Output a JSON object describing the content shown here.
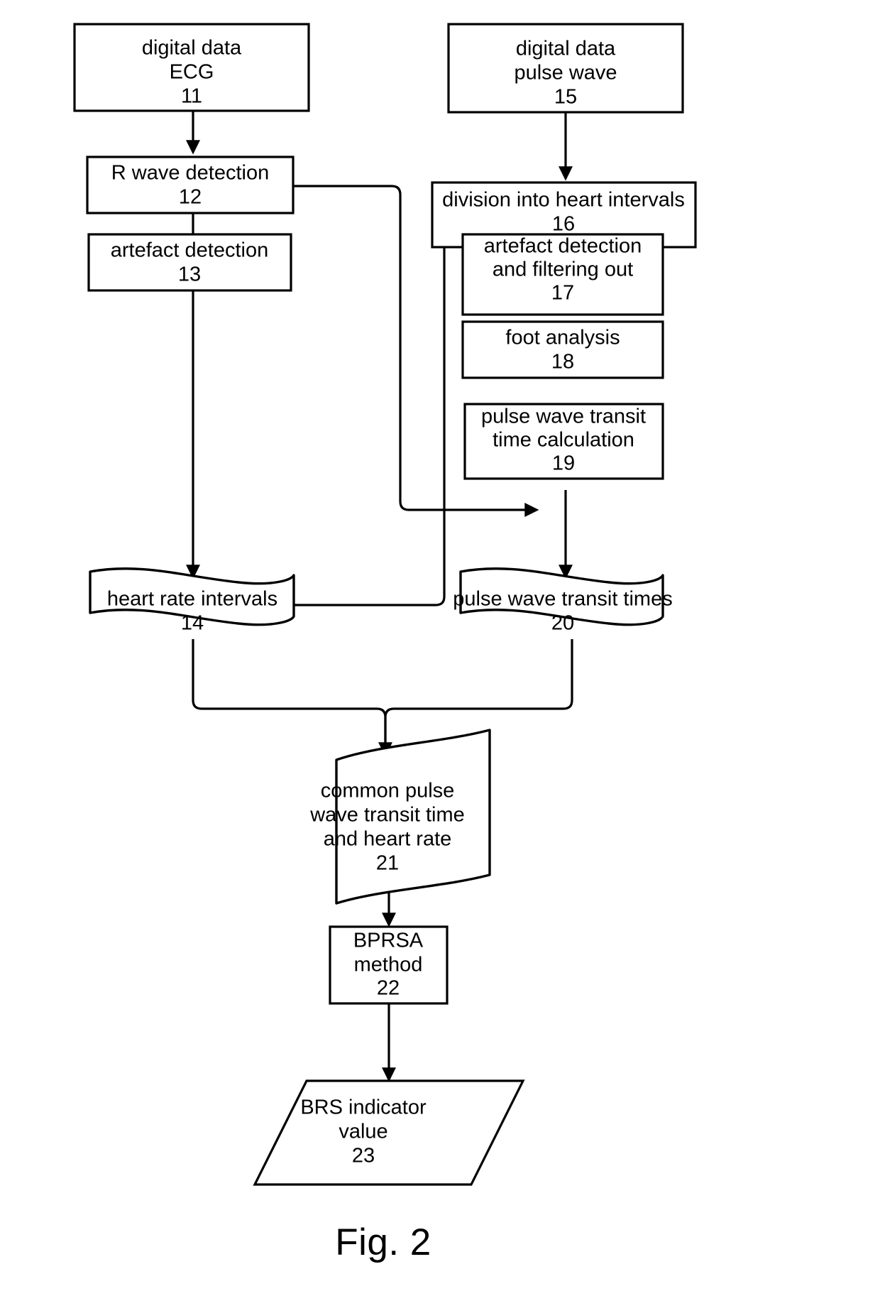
{
  "figure": {
    "caption": "Fig. 2",
    "type": "process-flow-diagram",
    "subject": "BRS indicator computation from ECG and pulse wave digital data"
  },
  "nodes": {
    "n11": {
      "shape": "rectangle",
      "line1": "digital data",
      "line2": "ECG",
      "ref": "11"
    },
    "n12": {
      "shape": "rectangle",
      "line1": "R wave detection",
      "line2": "",
      "ref": "12"
    },
    "n13": {
      "shape": "rectangle",
      "line1": "artefact detection",
      "line2": "",
      "ref": "13"
    },
    "n14": {
      "shape": "banner",
      "line1": "heart rate intervals",
      "line2": "",
      "ref": "14"
    },
    "n15": {
      "shape": "rectangle",
      "line1": "digital data",
      "line2": "pulse wave",
      "ref": "15"
    },
    "n16": {
      "shape": "rectangle",
      "line1": "division into heart intervals",
      "line2": "",
      "ref": "16"
    },
    "n17": {
      "shape": "rectangle",
      "line1": "artefact detection",
      "line2": "and filtering out",
      "ref": "17"
    },
    "n18": {
      "shape": "rectangle",
      "line1": "foot analysis",
      "line2": "",
      "ref": "18"
    },
    "n19": {
      "shape": "rectangle",
      "line1": "pulse wave transit",
      "line2": "time calculation",
      "ref": "19"
    },
    "n20": {
      "shape": "banner",
      "line1": "pulse wave transit times",
      "line2": "",
      "ref": "20"
    },
    "n21": {
      "shape": "banner",
      "line1": "common pulse",
      "line2": "wave transit time",
      "line3": "and heart rate",
      "ref": "21"
    },
    "n22": {
      "shape": "rectangle",
      "line1": "BPRSA",
      "line2": "method",
      "ref": "22"
    },
    "n23": {
      "shape": "parallelogram",
      "line1": "BRS indicator",
      "line2": "value",
      "ref": "23"
    }
  },
  "colors": {
    "stroke": "#000000",
    "fill": "#ffffff",
    "text": "#000000"
  }
}
